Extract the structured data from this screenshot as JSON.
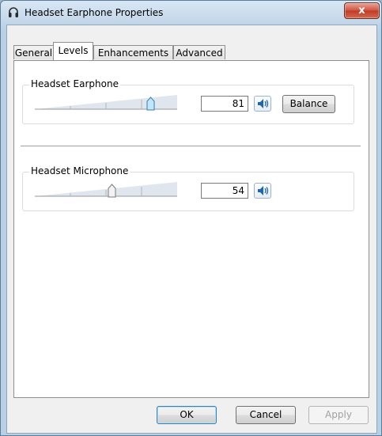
{
  "window": {
    "title": "Headset Earphone Properties",
    "close_label": "x"
  },
  "tabs": [
    {
      "label": "General",
      "active": false
    },
    {
      "label": "Levels",
      "active": true
    },
    {
      "label": "Enhancements",
      "active": false
    },
    {
      "label": "Advanced",
      "active": false
    }
  ],
  "earphone": {
    "label": "Headset Earphone",
    "value": "81",
    "level": 0.81,
    "balance_label": "Balance"
  },
  "microphone": {
    "label": "Headset Microphone",
    "value": "54",
    "level": 0.54
  },
  "buttons": {
    "ok": "OK",
    "cancel": "Cancel",
    "apply": "Apply"
  },
  "icons": {
    "title": "headset-icon",
    "speaker": "speaker-icon"
  },
  "colors": {
    "accent": "#3c7fb1",
    "close": "#c03a24"
  }
}
